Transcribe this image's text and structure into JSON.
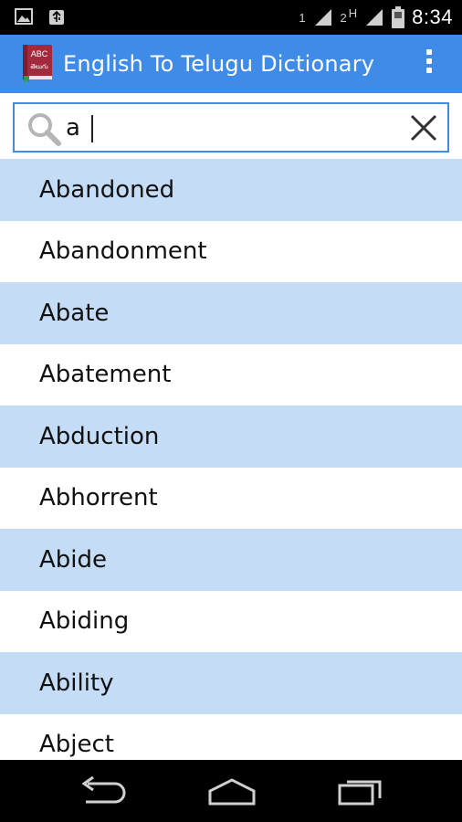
{
  "status_bar": {
    "sim1_label": "1",
    "sim2_label": "2",
    "data_label": "H",
    "time": "8:34",
    "icons": [
      "image-icon",
      "usb-icon",
      "signal-icon",
      "wifi-icon",
      "battery-icon"
    ]
  },
  "app_bar": {
    "icon_text_top": "ABC",
    "icon_text_bottom": "తెలుగు",
    "title": "English To Telugu Dictionary",
    "accent_color": "#3f8be8"
  },
  "search": {
    "value": "a",
    "placeholder": ""
  },
  "word_list": {
    "items": [
      {
        "label": "Abandoned"
      },
      {
        "label": "Abandonment"
      },
      {
        "label": "Abate"
      },
      {
        "label": "Abatement"
      },
      {
        "label": "Abduction"
      },
      {
        "label": "Abhorrent"
      },
      {
        "label": "Abide"
      },
      {
        "label": "Abiding"
      },
      {
        "label": "Ability"
      },
      {
        "label": "Abject"
      }
    ],
    "shade_color": "#c4dcf6"
  },
  "nav_bar": {
    "buttons": [
      "back-icon",
      "home-icon",
      "recents-icon"
    ]
  }
}
